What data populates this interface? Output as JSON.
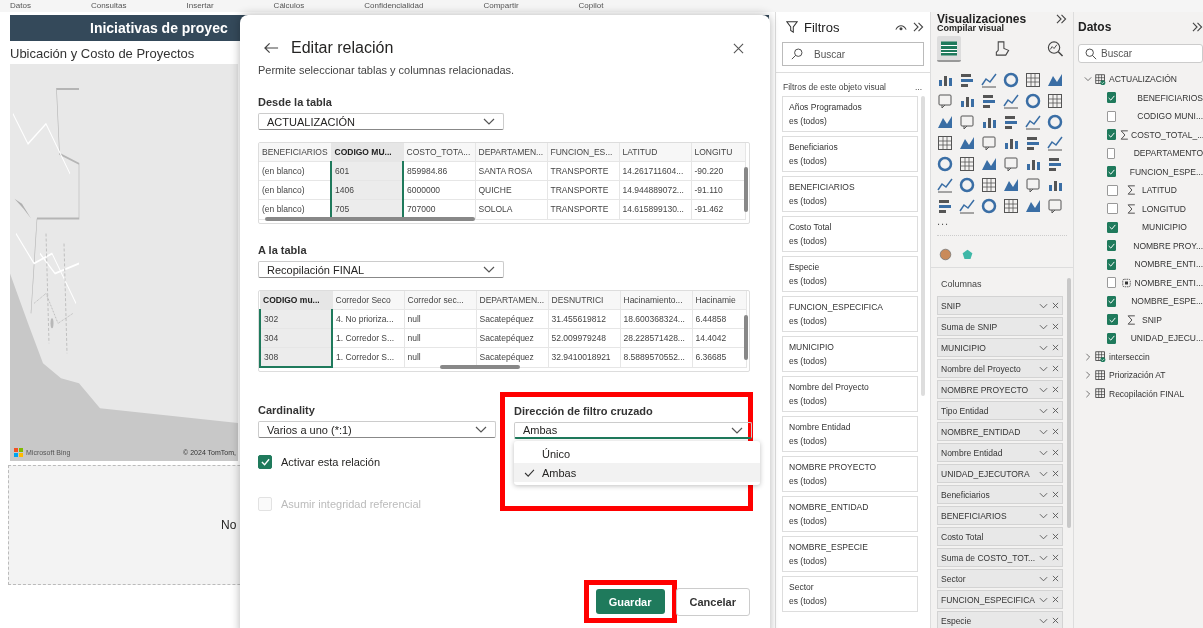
{
  "ribbon_tabs": [
    "Datos",
    "Consultas",
    "Insertar",
    "Cálculos",
    "Confidencialidad",
    "Compartir",
    "Copilot"
  ],
  "report": {
    "title": "Iniciativas de proyec",
    "subtitle": "Ubicación y Costo de Proyectos",
    "map_logo": "Microsoft Bing",
    "map_copyright": "© 2024 TomTom,",
    "empty_visual_text": "No"
  },
  "dialog": {
    "title": "Editar relación",
    "description": "Permite seleccionar tablas y columnas relacionadas.",
    "from_table": {
      "label": "Desde la tabla",
      "value": "ACTUALIZACIÓN",
      "columns": [
        {
          "name": "BENEFICIARIOS",
          "selected": false
        },
        {
          "name": "CODIGO MU...",
          "selected": true
        },
        {
          "name": "COSTO_TOTA...",
          "selected": false
        },
        {
          "name": "DEPARTAMEN...",
          "selected": false
        },
        {
          "name": "FUNCION_ES...",
          "selected": false
        },
        {
          "name": "LATITUD",
          "selected": false
        },
        {
          "name": "LONGITU",
          "selected": false
        }
      ],
      "rows": [
        [
          "(en blanco)",
          "601",
          "859984.86",
          "SANTA ROSA",
          "TRANSPORTE",
          "14.261711604...",
          "-90.220"
        ],
        [
          "(en blanco)",
          "1406",
          "6000000",
          "QUICHE",
          "TRANSPORTE",
          "14.944889072...",
          "-91.110"
        ],
        [
          "(en blanco)",
          "705",
          "707000",
          "SOLOLA",
          "TRANSPORTE",
          "14.615899130...",
          "-91.462"
        ]
      ]
    },
    "to_table": {
      "label": "A la tabla",
      "value": "Recopilación FINAL",
      "columns": [
        {
          "name": "CODIGO mu...",
          "selected": true
        },
        {
          "name": "Corredor Seco",
          "selected": false
        },
        {
          "name": "Corredor sec...",
          "selected": false
        },
        {
          "name": "DEPARTAMEN...",
          "selected": false
        },
        {
          "name": "DESNUTRICI",
          "selected": false
        },
        {
          "name": "Hacinamiento...",
          "selected": false
        },
        {
          "name": "Hacinamie",
          "selected": false
        }
      ],
      "rows": [
        [
          "302",
          "4. No prioriza...",
          "null",
          "Sacatepéquez",
          "31.455619812",
          "18.600368324...",
          "6.44858"
        ],
        [
          "304",
          "1. Corredor S...",
          "null",
          "Sacatepéquez",
          "52.009979248",
          "28.228571428...",
          "14.4042"
        ],
        [
          "308",
          "1. Corredor S...",
          "null",
          "Sacatepéquez",
          "32.9410018921",
          "8.5889570552...",
          "6.36685"
        ]
      ]
    },
    "cardinality": {
      "label": "Cardinality",
      "value": "Varios a uno (*:1)"
    },
    "cross_filter": {
      "label": "Dirección de filtro cruzado",
      "value": "Ambas",
      "options": [
        {
          "label": "Único",
          "selected": false
        },
        {
          "label": "Ambas",
          "selected": true
        }
      ]
    },
    "checkboxes": [
      {
        "label": "Activar esta relación",
        "checked": true,
        "disabled": false
      },
      {
        "label": "Asumir integridad referencial",
        "checked": false,
        "disabled": true
      }
    ],
    "buttons": [
      {
        "label": "Guardar",
        "kind": "primary"
      },
      {
        "label": "Cancelar",
        "kind": "secondary"
      }
    ]
  },
  "filters": {
    "title": "Filtros",
    "search_placeholder": "Buscar",
    "section": "Filtros de este objeto visual",
    "more": "...",
    "cards": [
      {
        "field": "Años Programados",
        "condition": "es (todos)"
      },
      {
        "field": "Beneficiarios",
        "condition": "es (todos)"
      },
      {
        "field": "BENEFICIARIOS",
        "condition": "es (todos)"
      },
      {
        "field": "Costo Total",
        "condition": "es (todos)"
      },
      {
        "field": "Especie",
        "condition": "es (todos)"
      },
      {
        "field": "FUNCION_ESPECIFICA",
        "condition": "es (todos)"
      },
      {
        "field": "MUNICIPIO",
        "condition": "es (todos)"
      },
      {
        "field": "Nombre del Proyecto",
        "condition": "es (todos)"
      },
      {
        "field": "Nombre Entidad",
        "condition": "es (todos)"
      },
      {
        "field": "NOMBRE PROYECTO",
        "condition": "es (todos)"
      },
      {
        "field": "NOMBRE_ENTIDAD",
        "condition": "es (todos)"
      },
      {
        "field": "NOMBRE_ESPECIE",
        "condition": "es (todos)"
      },
      {
        "field": "Sector",
        "condition": "es (todos)"
      }
    ]
  },
  "visualizations": {
    "title": "Visualizaciones",
    "build_label": "Compilar visual",
    "build_tabs": [
      {
        "selected": true
      },
      {
        "selected": false
      },
      {
        "selected": false
      }
    ],
    "more": "...",
    "columns_label": "Columnas",
    "fields": [
      "SNIP",
      "Suma de SNIP",
      "MUNICIPIO",
      "Nombre del Proyecto",
      "NOMBRE PROYECTO",
      "Tipo Entidad",
      "NOMBRE_ENTIDAD",
      "Nombre Entidad",
      "UNIDAD_EJECUTORA",
      "Beneficiarios",
      "BENEFICIARIOS",
      "Costo Total",
      "Suma de COSTO_TOT...",
      "Sector",
      "FUNCION_ESPECIFICA",
      "Especie"
    ]
  },
  "data": {
    "title": "Datos",
    "search_placeholder": "Buscar",
    "tables": [
      {
        "name": "ACTUALIZACIÓN",
        "expanded": true,
        "synced": true,
        "children": [
          {
            "name": "BENEFICIARIOS",
            "checked": true,
            "kind": "text"
          },
          {
            "name": "CODIGO MUNI...",
            "checked": false,
            "kind": "text"
          },
          {
            "name": "COSTO_TOTAL_...",
            "checked": true,
            "kind": "sum"
          },
          {
            "name": "DEPARTAMENTO",
            "checked": false,
            "kind": "text"
          },
          {
            "name": "FUNCION_ESPE...",
            "checked": true,
            "kind": "text"
          },
          {
            "name": "LATITUD",
            "checked": false,
            "kind": "sum"
          },
          {
            "name": "LONGITUD",
            "checked": false,
            "kind": "sum"
          },
          {
            "name": "MUNICIPIO",
            "checked": true,
            "kind": "text"
          },
          {
            "name": "NOMBRE PROY...",
            "checked": true,
            "kind": "text"
          },
          {
            "name": "NOMBRE_ENTI...",
            "checked": true,
            "kind": "text"
          },
          {
            "name": "NOMBRE_ENTI...",
            "checked": false,
            "kind": "calculated"
          },
          {
            "name": "NOMBRE_ESPE...",
            "checked": true,
            "kind": "text"
          },
          {
            "name": "SNIP",
            "checked": true,
            "kind": "sum"
          },
          {
            "name": "UNIDAD_EJECU...",
            "checked": true,
            "kind": "text"
          }
        ]
      },
      {
        "name": "interseccin",
        "expanded": false,
        "synced": true
      },
      {
        "name": "Priorización AT",
        "expanded": false,
        "synced": false
      },
      {
        "name": "Recopilación FINAL",
        "expanded": false,
        "synced": false
      }
    ]
  }
}
